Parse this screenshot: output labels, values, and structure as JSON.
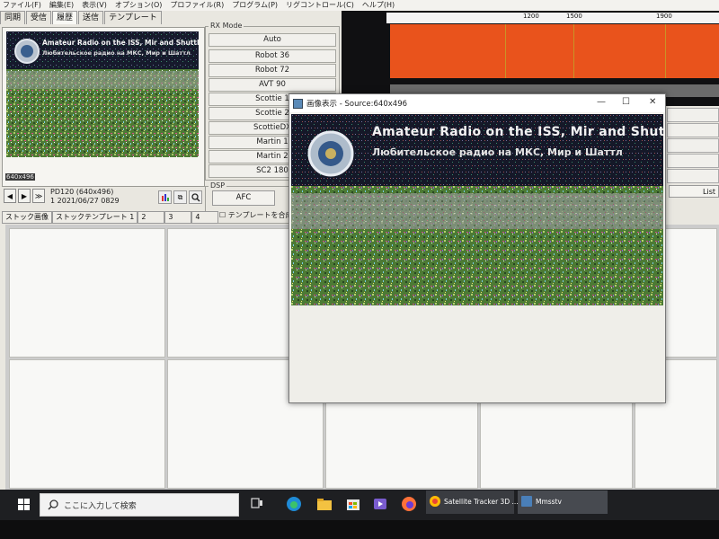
{
  "menubar": [
    "ファイル(F)",
    "編集(E)",
    "表示(V)",
    "オプション(O)",
    "プロファイル(R)",
    "プログラム(P)",
    "リグコントロール(C)",
    "ヘルプ(H)"
  ],
  "main_tabs": [
    "同期",
    "受信",
    "履歴",
    "送信",
    "テンプレート"
  ],
  "active_main_tab": "履歴",
  "thumbnail": {
    "banner_line1": "Amateur Radio on the ISS, Mir and Shuttle",
    "banner_line2": "Любительское радио на МКС, Мир и Шаттл",
    "size_label": "640x496",
    "mode_info": "PD120 (640x496)",
    "index_date": "1  2021/06/27 0829"
  },
  "rx_mode": {
    "legend": "RX Mode",
    "buttons": [
      "Auto",
      "Robot 36",
      "Robot 72",
      "AVT 90",
      "Scottie 1",
      "Scottie 2",
      "ScottieDX",
      "Martin 1",
      "Martin 2",
      "SC2 180"
    ]
  },
  "dsp": {
    "legend": "DSP",
    "afc": "AFC",
    "template_checkbox": "テンプレートを合成"
  },
  "stock_tabs": [
    "ストック画像",
    "ストックテンプレート 1",
    "2",
    "3",
    "4"
  ],
  "spectrum": {
    "scale_labels": [
      "1200",
      "1500",
      "1900"
    ],
    "list_label": "List",
    "colors": {
      "spectrum": "#e9531c",
      "marker": "#c99426"
    }
  },
  "popup": {
    "title": "画像表示 - Source:640x496",
    "controls": [
      "—",
      "☐",
      "✕"
    ],
    "image_text_line1": "Amateur Radio on the ISS, Mir and Shuttle",
    "image_text_line2": "Любительское радио на МКС, Мир и Шаттл"
  },
  "taskbar": {
    "search_placeholder": "ここに入力して検索",
    "apps": [
      "Satellite Tracker 3D ...",
      "Mmsstv"
    ]
  }
}
